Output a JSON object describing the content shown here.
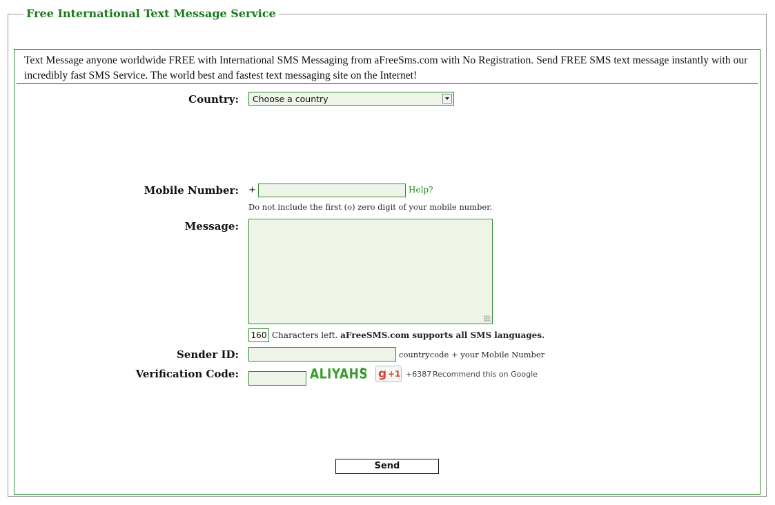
{
  "legend": "Free International Text Message Service",
  "intro": "Text Message anyone worldwide FREE with International SMS Messaging from aFreeSms.com with No Registration. Send FREE SMS text message instantly with our incredibly fast SMS Service. The world best and fastest text messaging site on the Internet!",
  "form": {
    "country_label": "Country:",
    "country_selected": "Choose a country",
    "mobile_label": "Mobile Number:",
    "mobile_prefix": "+",
    "mobile_value": "",
    "help_link": "Help?",
    "mobile_hint": "Do not include the first (o) zero digit of your mobile number.",
    "message_label": "Message:",
    "message_value": "",
    "chars_left_value": "160",
    "chars_left_text": "Characters left.",
    "languages_text": "aFreeSMS.com supports all SMS languages.",
    "sender_label": "Sender ID:",
    "sender_value": "",
    "sender_hint": "countrycode + your Mobile Number",
    "verification_label": "Verification Code:",
    "verification_value": "",
    "captcha_text": "ALIYAHS",
    "send_label": "Send"
  },
  "google_plus": {
    "g": "g",
    "plus_one": "+1",
    "count": "+6387",
    "recommend": "Recommend this on Google"
  },
  "colors": {
    "accent_green": "#1a7a1a",
    "field_border": "#2e8b2e",
    "field_bg": "#eef5e8",
    "gplus_red": "#d34836"
  }
}
